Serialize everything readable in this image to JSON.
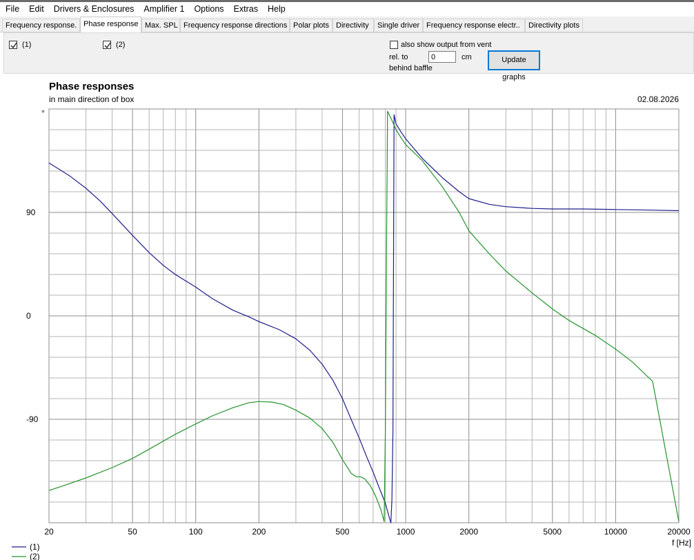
{
  "menu": [
    "File",
    "Edit",
    "Drivers & Enclosures",
    "Amplifier 1",
    "Options",
    "Extras",
    "Help"
  ],
  "tabs": [
    {
      "label": "Frequency response."
    },
    {
      "label": "Phase response"
    },
    {
      "label": "Max. SPL"
    },
    {
      "label": "Frequency response directions"
    },
    {
      "label": "Polar plots"
    },
    {
      "label": "Directivity"
    },
    {
      "label": "Single driver"
    },
    {
      "label": "Frequency response electr.."
    },
    {
      "label": "Directivity plots"
    }
  ],
  "active_tab": "Phase response",
  "controls": {
    "check1_label": "(1)",
    "check2_label": "(2)",
    "vent_label": "also show output from vent",
    "rel_to_label": "rel. to",
    "behind_label": "behind baffle",
    "offset_value": "0",
    "unit_label": "cm",
    "update_label": "Update graphs"
  },
  "colors": {
    "series1": "#1c1c8a",
    "series2": "#22922a",
    "grid": "#b4b4b4",
    "grid_major": "#8c8c8c"
  },
  "chart_data": {
    "type": "line",
    "title": "Phase responses",
    "subtitle": "in main direction of box",
    "date": "02.08.2026",
    "x_scale": "log",
    "xlim": [
      20,
      20000
    ],
    "ylim": [
      -180,
      180
    ],
    "x_ticks": [
      20,
      50,
      100,
      200,
      500,
      1000,
      2000,
      5000,
      10000,
      20000
    ],
    "y_ticks": [
      90,
      0,
      -90
    ],
    "y_unit": "°",
    "xlabel": "f [Hz]",
    "legend_position": "bottom-left",
    "series": [
      {
        "name": "(1)",
        "x": [
          20,
          25,
          30,
          35,
          40,
          50,
          60,
          70,
          80,
          100,
          120,
          150,
          180,
          200,
          250,
          300,
          350,
          400,
          450,
          500,
          550,
          600,
          650,
          700,
          750,
          800,
          840,
          850,
          860,
          870,
          880,
          900,
          950,
          1000,
          1100,
          1200,
          1500,
          1800,
          2000,
          2500,
          3000,
          4000,
          5000,
          7000,
          10000,
          15000,
          20000
        ],
        "y": [
          133,
          122,
          111,
          100,
          89,
          70,
          55,
          44,
          36,
          25,
          15,
          5,
          -1,
          -5,
          -12,
          -20,
          -30,
          -42,
          -56,
          -72,
          -90,
          -106,
          -122,
          -136,
          -150,
          -163,
          -177,
          -180,
          -160,
          -100,
          175,
          167,
          160,
          154,
          145,
          137,
          120,
          108,
          102,
          97,
          95,
          93.5,
          93,
          93,
          92.5,
          92,
          91.5
        ]
      },
      {
        "name": "(2)",
        "x": [
          20,
          25,
          30,
          40,
          50,
          60,
          80,
          100,
          120,
          150,
          180,
          200,
          230,
          260,
          300,
          350,
          400,
          450,
          500,
          550,
          580,
          610,
          640,
          680,
          720,
          760,
          790,
          800,
          810,
          820,
          850,
          900,
          950,
          1000,
          1200,
          1500,
          1800,
          2000,
          2500,
          3000,
          4000,
          5000,
          6000,
          8000,
          10000,
          12000,
          15000,
          20000
        ],
        "y": [
          -152,
          -146,
          -141,
          -132,
          -124,
          -116,
          -103,
          -94,
          -87,
          -80,
          -75.5,
          -74.5,
          -75,
          -77,
          -82,
          -89,
          -98,
          -110,
          -125,
          -137,
          -140,
          -140,
          -142,
          -148,
          -157,
          -168,
          -179,
          -100,
          50,
          178,
          172,
          162,
          155,
          149,
          135,
          112,
          90,
          74,
          54,
          39,
          20,
          6,
          -4,
          -17,
          -29,
          -40,
          -57,
          -179
        ]
      }
    ]
  }
}
